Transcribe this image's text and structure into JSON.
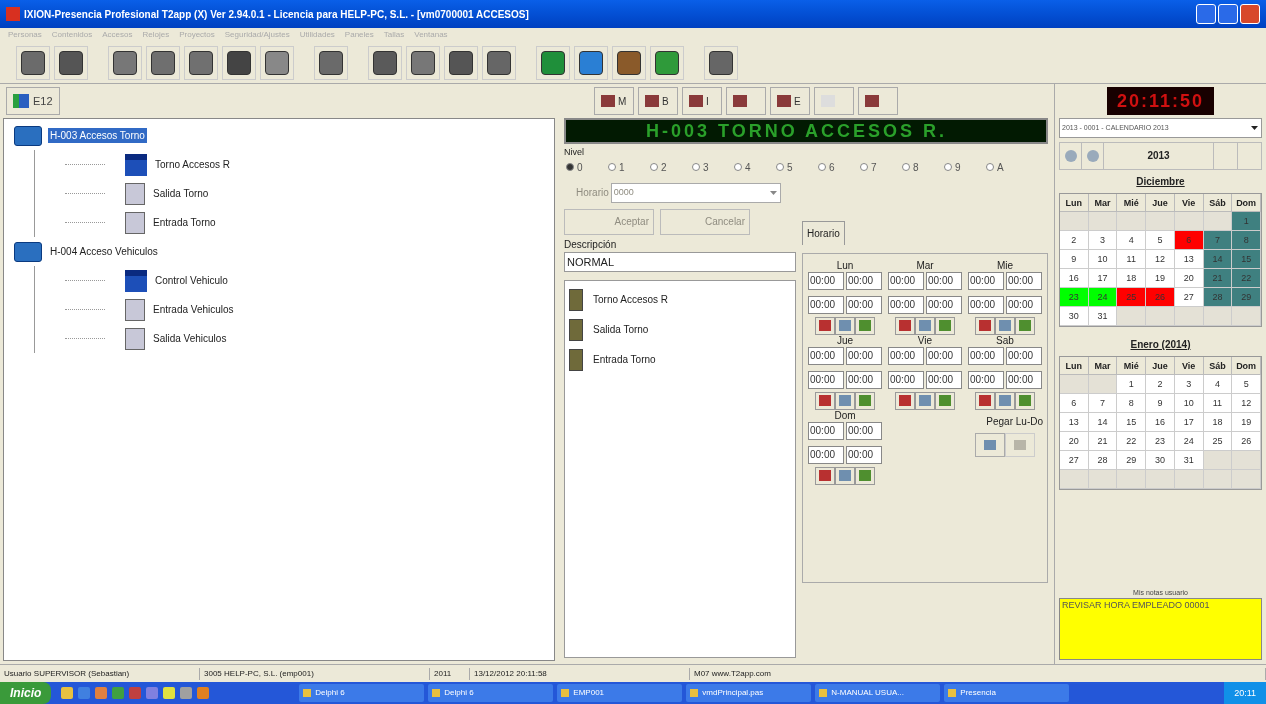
{
  "window": {
    "title": "IXION-Presencia Profesional T2app (X) Ver 2.94.0.1  -  Licencia para HELP-PC, S.L. - [vm0700001 ACCESOS]"
  },
  "menu": [
    "Personas",
    "Contenidos",
    "Accesos",
    "Relojes",
    "Proyectos",
    "Seguridad/Ajustes",
    "Utilidades",
    "Paneles",
    "Tallas",
    "Ventanas"
  ],
  "tree_tab": {
    "label": "E12"
  },
  "tree": [
    {
      "label": "H-003 Accesos Torno",
      "selected": true,
      "children": [
        {
          "label": "Torno Accesos R",
          "kind": "reader",
          "selected": false
        },
        {
          "label": "Salida Torno",
          "kind": "door",
          "selected": false
        },
        {
          "label": "Entrada Torno",
          "kind": "door",
          "selected": false
        }
      ]
    },
    {
      "label": "H-004 Acceso Vehiculos",
      "selected": false,
      "children": [
        {
          "label": "Control Vehiculo",
          "kind": "reader",
          "selected": false
        },
        {
          "label": "Entrada Vehiculos",
          "kind": "door",
          "selected": false
        },
        {
          "label": "Salida Vehiculos",
          "kind": "door",
          "selected": false
        }
      ]
    }
  ],
  "action_buttons": [
    {
      "letter": "M",
      "disabled": false
    },
    {
      "letter": "B",
      "disabled": false
    },
    {
      "letter": "I",
      "disabled": false
    },
    {
      "disabled": false
    },
    {
      "letter": "E",
      "disabled": false
    },
    {
      "disabled": true
    },
    {
      "disabled": false
    }
  ],
  "led_display": "H-003 TORNO ACCESOS R.",
  "nivel": {
    "label": "Nivel",
    "options": [
      {
        "label": "0",
        "selected": true
      },
      {
        "label": "1",
        "selected": false
      },
      {
        "label": "2",
        "selected": false
      },
      {
        "label": "3",
        "selected": false
      },
      {
        "label": "4",
        "selected": false
      },
      {
        "label": "5",
        "selected": false
      },
      {
        "label": "6",
        "selected": false
      },
      {
        "label": "7",
        "selected": false
      },
      {
        "label": "8",
        "selected": false
      },
      {
        "label": "9",
        "selected": false
      },
      {
        "label": "A",
        "selected": false
      }
    ]
  },
  "horario_field": {
    "label": "Horario",
    "value": "0000",
    "disabled": true
  },
  "buttons": [
    {
      "label": "Aceptar",
      "disabled": true
    },
    {
      "label": "Cancelar",
      "disabled": true
    }
  ],
  "descripcion": {
    "label": "Descripción",
    "value": "NORMAL"
  },
  "devices": [
    "Torno Accesos R",
    "Salida Torno",
    "Entrada Torno"
  ],
  "tabs": [
    {
      "label": "Horario",
      "selected": true
    }
  ],
  "schedule": [
    {
      "day": "Lun",
      "times": [
        "00:00",
        "00:00",
        "00:00",
        "00:00"
      ]
    },
    {
      "day": "Mar",
      "times": [
        "00:00",
        "00:00",
        "00:00",
        "00:00"
      ]
    },
    {
      "day": "Mie",
      "times": [
        "00:00",
        "00:00",
        "00:00",
        "00:00"
      ]
    },
    {
      "day": "Jue",
      "times": [
        "00:00",
        "00:00",
        "00:00",
        "00:00"
      ]
    },
    {
      "day": "Vie",
      "times": [
        "00:00",
        "00:00",
        "00:00",
        "00:00"
      ]
    },
    {
      "day": "Sab",
      "times": [
        "00:00",
        "00:00",
        "00:00",
        "00:00"
      ]
    },
    {
      "day": "Dom",
      "times": [
        "00:00",
        "00:00",
        "00:00",
        "00:00"
      ]
    }
  ],
  "paste": {
    "label": "Pegar Lu-Do"
  },
  "clock": "20:11:50",
  "calendar_select": "2013 - 0001 - CALENDARIO 2013",
  "year": "2013",
  "months": [
    {
      "title": "Diciembre",
      "weekdays": [
        "Lun",
        "Mar",
        "Mié",
        "Jue",
        "Vie",
        "Sáb",
        "Dom"
      ],
      "cells": [
        {
          "kind": "blank"
        },
        {
          "kind": "blank"
        },
        {
          "kind": "blank"
        },
        {
          "kind": "blank"
        },
        {
          "kind": "blank"
        },
        {
          "kind": "blank"
        },
        {
          "kind": "day",
          "label": "1",
          "color": "#3f8080"
        },
        {
          "kind": "day",
          "label": "2"
        },
        {
          "kind": "day",
          "label": "3"
        },
        {
          "kind": "day",
          "label": "4"
        },
        {
          "kind": "day",
          "label": "5"
        },
        {
          "kind": "day",
          "label": "6",
          "color": "#ff0000"
        },
        {
          "kind": "day",
          "label": "7",
          "color": "#3f8080"
        },
        {
          "kind": "day",
          "label": "8",
          "color": "#3f8080"
        },
        {
          "kind": "day",
          "label": "9"
        },
        {
          "kind": "day",
          "label": "10"
        },
        {
          "kind": "day",
          "label": "11"
        },
        {
          "kind": "day",
          "label": "12"
        },
        {
          "kind": "day",
          "label": "13"
        },
        {
          "kind": "day",
          "label": "14",
          "color": "#3f8080"
        },
        {
          "kind": "day",
          "label": "15",
          "color": "#3f8080"
        },
        {
          "kind": "day",
          "label": "16"
        },
        {
          "kind": "day",
          "label": "17"
        },
        {
          "kind": "day",
          "label": "18"
        },
        {
          "kind": "day",
          "label": "19"
        },
        {
          "kind": "day",
          "label": "20"
        },
        {
          "kind": "day",
          "label": "21",
          "color": "#3f8080"
        },
        {
          "kind": "day",
          "label": "22",
          "color": "#3f8080"
        },
        {
          "kind": "day",
          "label": "23",
          "color": "#00ff00"
        },
        {
          "kind": "day",
          "label": "24",
          "color": "#00ff00"
        },
        {
          "kind": "day",
          "label": "25",
          "color": "#ff0000"
        },
        {
          "kind": "day",
          "label": "26",
          "color": "#ff0000"
        },
        {
          "kind": "day",
          "label": "27"
        },
        {
          "kind": "day",
          "label": "28",
          "color": "#3f8080"
        },
        {
          "kind": "day",
          "label": "29",
          "color": "#3f8080"
        },
        {
          "kind": "day",
          "label": "30"
        },
        {
          "kind": "day",
          "label": "31"
        },
        {
          "kind": "blank"
        },
        {
          "kind": "blank"
        },
        {
          "kind": "blank"
        },
        {
          "kind": "blank"
        },
        {
          "kind": "blank"
        }
      ]
    },
    {
      "title": "Enero (2014)",
      "weekdays": [
        "Lun",
        "Mar",
        "Mié",
        "Jue",
        "Vie",
        "Sáb",
        "Dom"
      ],
      "cells": [
        {
          "kind": "blank"
        },
        {
          "kind": "blank"
        },
        {
          "kind": "day",
          "label": "1"
        },
        {
          "kind": "day",
          "label": "2"
        },
        {
          "kind": "day",
          "label": "3"
        },
        {
          "kind": "day",
          "label": "4"
        },
        {
          "kind": "day",
          "label": "5"
        },
        {
          "kind": "day",
          "label": "6"
        },
        {
          "kind": "day",
          "label": "7"
        },
        {
          "kind": "day",
          "label": "8"
        },
        {
          "kind": "day",
          "label": "9"
        },
        {
          "kind": "day",
          "label": "10"
        },
        {
          "kind": "day",
          "label": "11"
        },
        {
          "kind": "day",
          "label": "12"
        },
        {
          "kind": "day",
          "label": "13"
        },
        {
          "kind": "day",
          "label": "14"
        },
        {
          "kind": "day",
          "label": "15"
        },
        {
          "kind": "day",
          "label": "16"
        },
        {
          "kind": "day",
          "label": "17"
        },
        {
          "kind": "day",
          "label": "18"
        },
        {
          "kind": "day",
          "label": "19"
        },
        {
          "kind": "day",
          "label": "20"
        },
        {
          "kind": "day",
          "label": "21"
        },
        {
          "kind": "day",
          "label": "22"
        },
        {
          "kind": "day",
          "label": "23"
        },
        {
          "kind": "day",
          "label": "24"
        },
        {
          "kind": "day",
          "label": "25"
        },
        {
          "kind": "day",
          "label": "26"
        },
        {
          "kind": "day",
          "label": "27"
        },
        {
          "kind": "day",
          "label": "28"
        },
        {
          "kind": "day",
          "label": "29"
        },
        {
          "kind": "day",
          "label": "30"
        },
        {
          "kind": "day",
          "label": "31"
        },
        {
          "kind": "blank"
        },
        {
          "kind": "blank"
        },
        {
          "kind": "blank"
        },
        {
          "kind": "blank"
        },
        {
          "kind": "blank"
        },
        {
          "kind": "blank"
        },
        {
          "kind": "blank"
        },
        {
          "kind": "blank"
        },
        {
          "kind": "blank"
        }
      ]
    }
  ],
  "notes": {
    "title": "Mis notas usuario",
    "text": "REVISAR HORA EMPLEADO 00001"
  },
  "status_bar": [
    "Usuario SUPERVISOR (Sebastian)",
    "3005 HELP-PC, S.L. (emp001)",
    "2011",
    "13/12/2012 20:11:58",
    "M07 www.T2app.com"
  ],
  "taskbar": {
    "start": "Inicio",
    "tasks": [
      "Delphi 6",
      "Delphi 6",
      "EMP001",
      "vmdPrincipal.pas",
      "N-MANUAL USUA...",
      "Presencia"
    ],
    "clock": "20:11"
  }
}
